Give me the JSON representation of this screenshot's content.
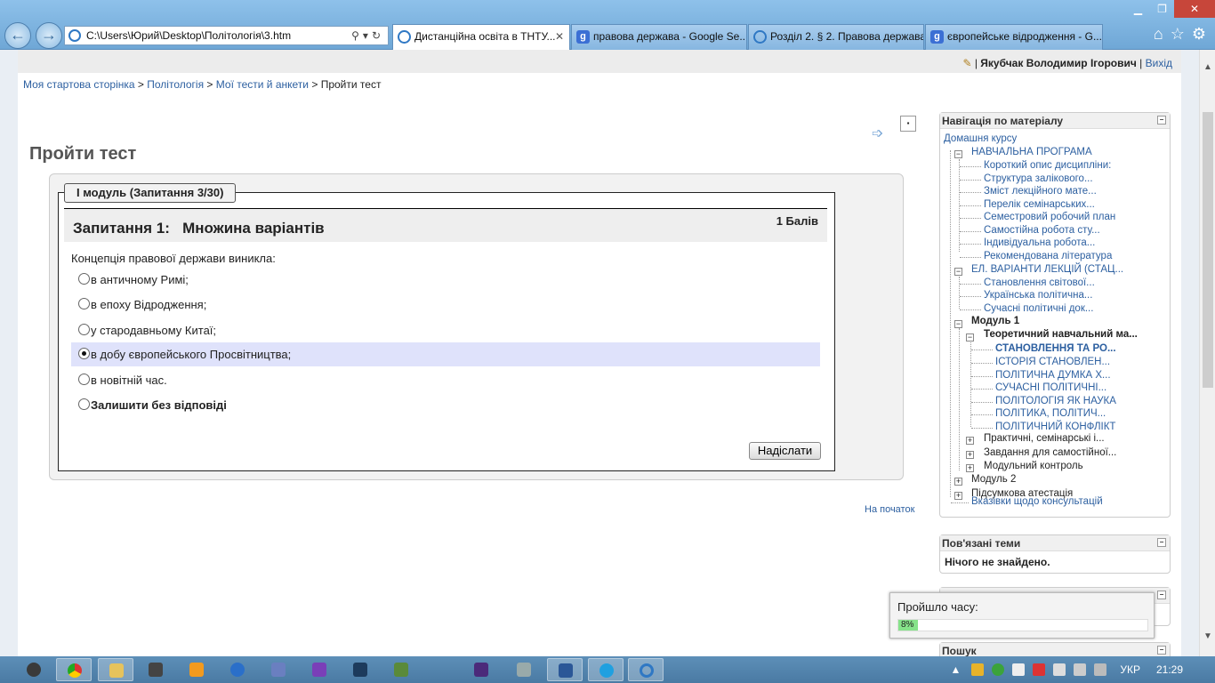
{
  "browser": {
    "address": "C:\\Users\\Юрий\\Desktop\\Політологія\\3.htm",
    "tabs": [
      {
        "label": "Дистанційна освіта в ТНТУ...",
        "active": true,
        "icon": "ie-icon"
      },
      {
        "label": "правова держава - Google Se...",
        "active": false,
        "icon": "google-icon"
      },
      {
        "label": "Розділ 2. § 2. Правова держава.",
        "active": false,
        "icon": "ie-icon"
      },
      {
        "label": "європейське відродження - G...",
        "active": false,
        "icon": "google-icon"
      }
    ]
  },
  "userbar": {
    "name": "Якубчак Володимир Ігорович",
    "logout": "Вихід"
  },
  "breadcrumb": [
    "Моя стартова сторінка",
    "Політологія",
    "Мої тести й анкети",
    "Пройти тест"
  ],
  "page_title": "Пройти тест",
  "quiz": {
    "legend": "I модуль (Запитання 3/30)",
    "question_title": "Запитання 1:   Множина варіантів",
    "points": "1 Балів",
    "question_text": "Концепція правової держави виникла:",
    "options": [
      {
        "label": "в античному Римі;",
        "selected": false
      },
      {
        "label": "в епоху Відродження;",
        "selected": false
      },
      {
        "label": "у стародавньому Китаї;",
        "selected": false
      },
      {
        "label": "в добу європейського Просвітництва;",
        "selected": true
      },
      {
        "label": "в новітній час.",
        "selected": false
      },
      {
        "label": "Залишити без відповіді",
        "selected": false
      }
    ],
    "submit": "Надіслати",
    "to_top": "На початок"
  },
  "nav_block": {
    "title": "Навігація по матеріалу",
    "home": "Домашня курсу",
    "program": "НАВЧАЛЬНА ПРОГРАМА",
    "program_items": [
      "Короткий опис дисципліни:",
      "Структура залікового...",
      "Зміст лекційного мате...",
      "Перелік семінарських...",
      "Семестровий робочий план",
      "Самостійна робота сту...",
      "Індивідуальна робота...",
      "Рекомендована література"
    ],
    "lectures": "ЕЛ. ВАРІАНТИ ЛЕКЦІЙ (СТАЦ...",
    "lecture_items": [
      "Становлення світової...",
      "Українська політична...",
      "Сучасні політичні док..."
    ],
    "module1": "Модуль 1",
    "theory": "Теоретичний навчальний ма...",
    "theory_items": [
      "СТАНОВЛЕННЯ ТА РО...",
      "ІСТОРІЯ СТАНОВЛЕН...",
      "ПОЛІТИЧНА ДУМКА Х...",
      "СУЧАСНІ ПОЛІТИЧНІ...",
      "ПОЛІТОЛОГІЯ ЯК НАУКА",
      "ПОЛІТИКА, ПОЛІТИЧ...",
      "ПОЛІТИЧНИЙ КОНФЛІКТ"
    ],
    "practical": "Практичні, семінарські і...",
    "selfwork": "Завдання для самостійної...",
    "control": "Модульний контроль",
    "module2": "Модуль 2",
    "final": "Підсумкова атестація",
    "consult": "Вказівки щодо консультацій"
  },
  "related_block": {
    "title": "Пов'язані теми",
    "empty": "Нічого не знайдено."
  },
  "timer": {
    "label": "Пройшло часу:",
    "progress_text": "8%",
    "progress": 0.08
  },
  "search_block": {
    "title": "Пошук"
  },
  "taskbar": {
    "language": "УКР",
    "time": "21:29"
  }
}
